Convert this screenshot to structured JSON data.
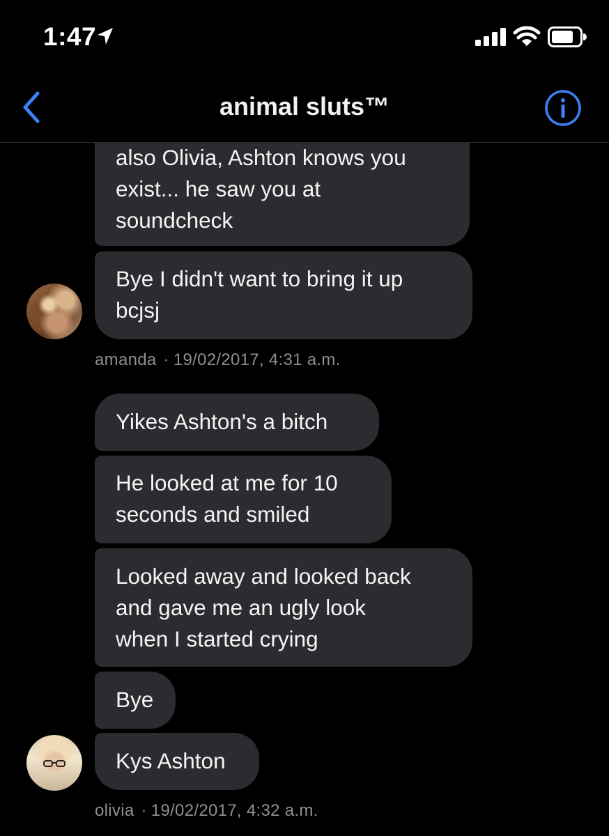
{
  "status_bar": {
    "time": "1:47",
    "icons": [
      "location-arrow-icon",
      "cellular-signal-icon",
      "wifi-icon",
      "battery-icon"
    ]
  },
  "nav": {
    "title": "animal sluts™",
    "back_icon": "chevron-left-icon",
    "info_icon": "info-circle-icon",
    "accent_color": "#3a82f7"
  },
  "messages": [
    {
      "lines": [
        "also Olivia, Ashton knows you",
        "exist... he saw you at",
        "soundcheck"
      ]
    },
    {
      "lines": [
        "Bye I didn't want to bring it up",
        "bcjsj"
      ]
    },
    {
      "lines": [
        "Yikes Ashton's a bitch"
      ]
    },
    {
      "lines": [
        "He looked at me for 10",
        "seconds and smiled"
      ]
    },
    {
      "lines": [
        "Looked away and looked back",
        "and gave me an ugly look",
        "when I started crying"
      ]
    },
    {
      "lines": [
        "Bye"
      ]
    },
    {
      "lines": [
        "Kys Ashton"
      ]
    }
  ],
  "groups": [
    {
      "sender": "amanda",
      "separator": "·",
      "timestamp": "19/02/2017, 4:31 a.m."
    },
    {
      "sender": "olivia",
      "separator": "·",
      "timestamp": "19/02/2017, 4:32 a.m."
    }
  ],
  "colors": {
    "background": "#000000",
    "bubble": "#2b2c30",
    "meta_text": "#8e8e93"
  }
}
